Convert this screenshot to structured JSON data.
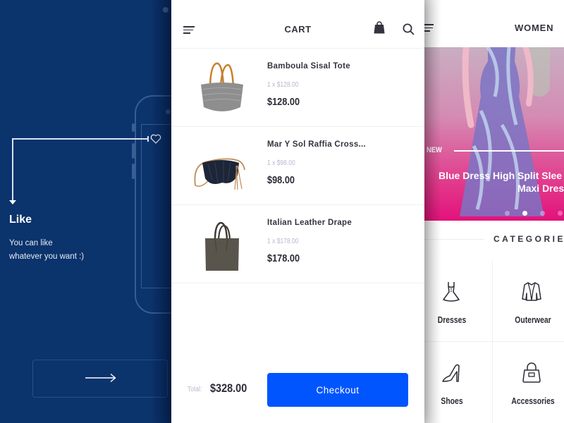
{
  "onboarding": {
    "title": "Like",
    "description_line1": "You can like",
    "description_line2": "whatever you want :)",
    "next_icon": "arrow-right-icon",
    "feature_icon": "heart-icon"
  },
  "cart": {
    "title": "CART",
    "header_icons": [
      "menu-icon",
      "shopping-bag-icon",
      "search-icon"
    ],
    "items": [
      {
        "name": "Bamboula Sisal Tote",
        "qty_line": "1 x $128.00",
        "price": "$128.00"
      },
      {
        "name": "Mar Y Sol Raffia Cross...",
        "qty_line": "1 x $98.00",
        "price": "$98.00"
      },
      {
        "name": "Italian Leather Drape",
        "qty_line": "1 x $178.00",
        "price": "$178.00"
      }
    ],
    "total_label": "Total:",
    "total_value": "$328.00",
    "checkout_label": "Checkout",
    "accent_color": "#0055ff"
  },
  "women": {
    "title": "WOMEN",
    "hero": {
      "badge": "NEW",
      "title_line1": "Blue Dress High Split Slee",
      "title_line2": "Maxi Dress",
      "slides_total": 4,
      "active_slide": 2
    },
    "categories_title": "CATEGORIE",
    "categories": [
      {
        "label": "Dresses",
        "icon": "dress-icon"
      },
      {
        "label": "Outerwear",
        "icon": "jacket-icon"
      },
      {
        "label": "Shoes",
        "icon": "high-heel-icon"
      },
      {
        "label": "Accessories",
        "icon": "handbag-icon"
      }
    ]
  },
  "colors": {
    "onboarding_bg": "#0b336c",
    "hero_pink": "#e2127a",
    "text_dark": "#33343f",
    "text_muted": "#b8b8d0"
  }
}
